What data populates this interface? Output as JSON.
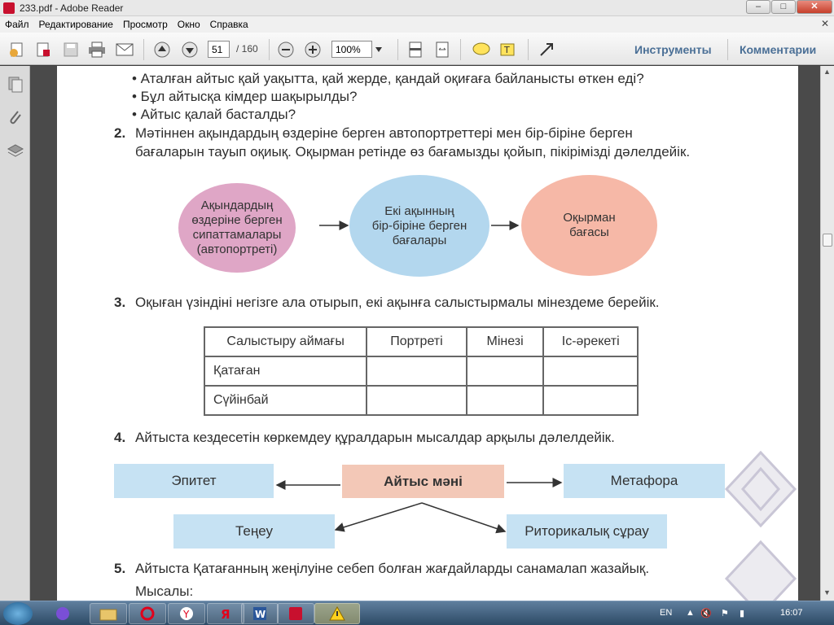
{
  "window": {
    "title": "233.pdf - Adobe Reader",
    "min": "–",
    "max": "□",
    "close": "✕"
  },
  "menu": [
    "Файл",
    "Редактирование",
    "Просмотр",
    "Окно",
    "Справка"
  ],
  "menu_close": "✕",
  "toolbar": {
    "page_current": "51",
    "page_total": "/ 160",
    "zoom": "100%",
    "tools": "Инструменты",
    "comments": "Комментарии"
  },
  "content": {
    "bullets": [
      "• Аталған айтыс қай уақытта, қай жерде, қандай оқиғаға байланысты өткен еді?",
      "• Бұл айтысқа кімдер шақырылды?",
      "• Айтыс қалай басталды?"
    ],
    "q2_num": "2.",
    "q2_line1": "Мәтіннен ақындардың өздеріне берген автопортреттері мен бір-біріне берген",
    "q2_line2": "бағаларын тауып оқиық. Оқырман ретінде өз бағамызды қойып, пікірімізді дәлелдейік.",
    "oval1": [
      "Ақындардың",
      "өздеріне берген",
      "сипаттамалары",
      "(автопортреті)"
    ],
    "oval2": [
      "Екі ақынның",
      "бір-біріне берген",
      "бағалары"
    ],
    "oval3": [
      "Оқырман",
      "бағасы"
    ],
    "q3_num": "3.",
    "q3_text": "Оқыған үзіндіні негізге ала отырып, екі ақынға салыстырмалы мінездеме берейік.",
    "table_head": [
      "Салыстыру аймағы",
      "Портреті",
      "Мінезі",
      "Іс-әрекеті"
    ],
    "table_rows": [
      "Қатаған",
      "Сүйінбай"
    ],
    "q4_num": "4.",
    "q4_text": "Айтыста кездесетін көркемдеу құралдарын мысалдар арқылы дәлелдейік.",
    "center_box": "Айтыс мәні",
    "box_left": "Эпитет",
    "box_right": "Метафора",
    "box_bl": "Теңеу",
    "box_br": "Риторикалық сұрау",
    "q5_num": "5.",
    "q5_text": "Айтыста Қатағанның жеңілуіне себеп болған жағдайларды санамалап жазайық.",
    "example": "Мысалы:"
  },
  "colors": {
    "oval1": "#dfa6c6",
    "oval2": "#b3d7ee",
    "oval3": "#f6b8a7",
    "box_blue": "#c6e2f3",
    "box_peach": "#f3c8b7"
  },
  "taskbar": {
    "lang": "EN",
    "time": "16:07"
  }
}
